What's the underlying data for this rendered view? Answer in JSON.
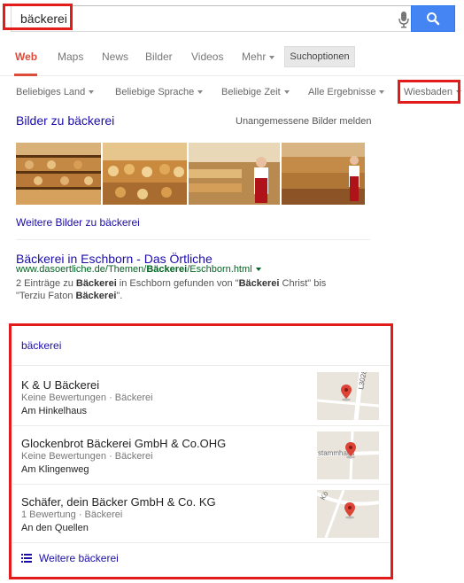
{
  "search": {
    "query": "bäckerei"
  },
  "tabs": [
    {
      "label": "Web",
      "active": true
    },
    {
      "label": "Maps"
    },
    {
      "label": "News"
    },
    {
      "label": "Bilder"
    },
    {
      "label": "Videos"
    },
    {
      "label": "Mehr"
    }
  ],
  "search_options_label": "Suchoptionen",
  "filters": [
    {
      "label": "Beliebiges Land"
    },
    {
      "label": "Beliebige Sprache"
    },
    {
      "label": "Beliebige Zeit"
    },
    {
      "label": "Alle Ergebnisse"
    },
    {
      "label": "Wiesbaden"
    }
  ],
  "images": {
    "header": "Bilder zu bäckerei",
    "report_label": "Unangemessene Bilder melden",
    "more_label": "Weitere Bilder zu bäckerei"
  },
  "result": {
    "title": "Bäckerei in Eschborn - Das Örtliche",
    "url_prefix": "www.dasoertliche.de/Themen/",
    "url_bold": "Bäckerei",
    "url_suffix": "/Eschborn.html",
    "snippet_1": "2 Einträge zu ",
    "snippet_b1": "Bäckerei",
    "snippet_2": " in Eschborn gefunden von \"",
    "snippet_b2": "Bäckerei",
    "snippet_3": " Christ\" bis \"Terziu Faton ",
    "snippet_b3": "Bäckerei",
    "snippet_4": "\"."
  },
  "local": {
    "title": "bäckerei",
    "businesses": [
      {
        "name": "K & U Bäckerei",
        "meta": "Keine Bewertungen · Bäckerei",
        "address": "Am Hinkelhaus",
        "map_label": "L3028"
      },
      {
        "name": "Glockenbrot Bäckerei GmbH & Co.OHG",
        "meta": "Keine Bewertungen · Bäckerei",
        "address": "Am Klingenweg",
        "map_label": "stammhaus"
      },
      {
        "name": "Schäfer, dein Bäcker GmbH & Co. KG",
        "meta": "1 Bewertung · Bäckerei",
        "address": "An den Quellen",
        "map_label": "Kö"
      }
    ],
    "more_label": "Weitere bäckerei"
  },
  "colors": {
    "highlight": "#e21b1b",
    "link": "#1a0dab",
    "url_green": "#006621",
    "search_blue": "#4585f3",
    "tab_active": "#dd4b39",
    "map_pin": "#db4437"
  }
}
